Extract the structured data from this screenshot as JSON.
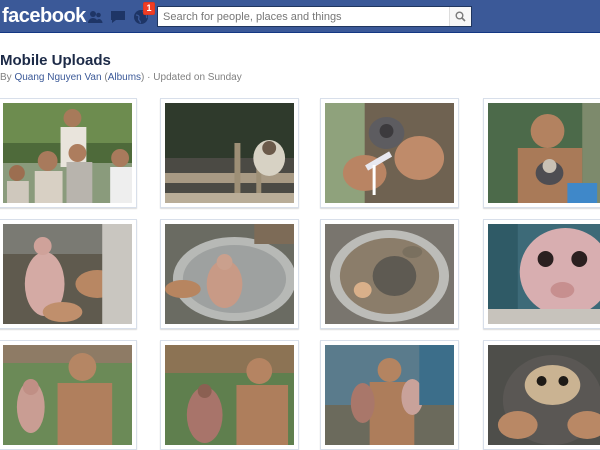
{
  "header": {
    "logo": "facebook",
    "notification_count": "1",
    "search": {
      "placeholder": "Search for people, places and things"
    },
    "icons": [
      "friends-icon",
      "messages-icon",
      "globe-notifications-icon",
      "search-icon"
    ]
  },
  "album": {
    "title": "Mobile Uploads",
    "by": "By",
    "author": "Quang Nguyen Van",
    "open_paren": "(",
    "albums_link": "Albums",
    "close_paren": ")",
    "separator": "·",
    "updated": "Updated on Sunday"
  },
  "colors": {
    "brand": "#3b5998",
    "title": "#1c2a47",
    "link": "#3b5998",
    "muted": "#808080",
    "badge": "#f03d25"
  },
  "photos": [
    {
      "id": 1,
      "subject": "group of young men outdoors"
    },
    {
      "id": 2,
      "subject": "monkey behind wooden cage bars"
    },
    {
      "id": 3,
      "subject": "hands holding monkey with syringe"
    },
    {
      "id": 4,
      "subject": "young man holding small monkey"
    },
    {
      "id": 5,
      "subject": "skinned monkey on table"
    },
    {
      "id": 6,
      "subject": "monkey in metal basin"
    },
    {
      "id": 7,
      "subject": "animals in pot of water"
    },
    {
      "id": 8,
      "subject": "close-up of skinned monkey face"
    },
    {
      "id": 9,
      "subject": "shirtless young man holding skinned monkeys"
    },
    {
      "id": 10,
      "subject": "shirtless young man holding animal"
    },
    {
      "id": 11,
      "subject": "young man holding two small animals"
    },
    {
      "id": 12,
      "subject": "close-up of furry monkey face"
    }
  ]
}
